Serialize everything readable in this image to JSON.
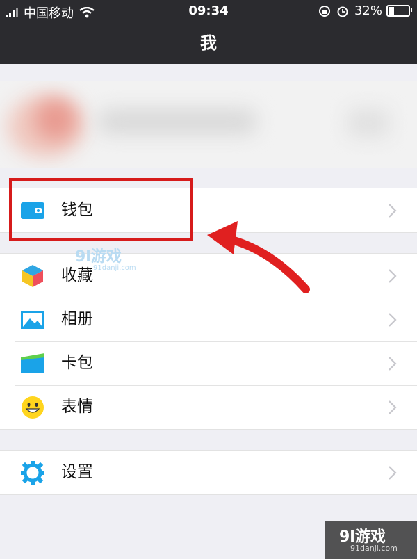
{
  "status_bar": {
    "carrier": "中国移动",
    "time": "09:34",
    "battery_percent": "32%",
    "battery_level": 0.32,
    "signal_bars": 4,
    "icons": [
      "signal-icon",
      "wifi-icon",
      "rotation-lock-icon",
      "alarm-icon",
      "battery-icon"
    ]
  },
  "nav": {
    "title": "我"
  },
  "menu": {
    "wallet": {
      "label": "钱包",
      "icon": "wallet-icon"
    },
    "items": [
      {
        "label": "收藏",
        "icon": "favorites-cube-icon"
      },
      {
        "label": "相册",
        "icon": "album-picture-icon"
      },
      {
        "label": "卡包",
        "icon": "card-pack-icon"
      },
      {
        "label": "表情",
        "icon": "smiley-face-icon"
      }
    ],
    "settings": {
      "label": "设置",
      "icon": "gear-icon"
    }
  },
  "annotation": {
    "arrow_color": "#e02020",
    "box_color": "#d61b1b"
  },
  "watermark": {
    "text": "9l游戏",
    "url": "91danji.com"
  },
  "colors": {
    "header_bg": "#2b2b2f",
    "accent_blue": "#1aa3e8",
    "page_bg": "#efeff4"
  }
}
